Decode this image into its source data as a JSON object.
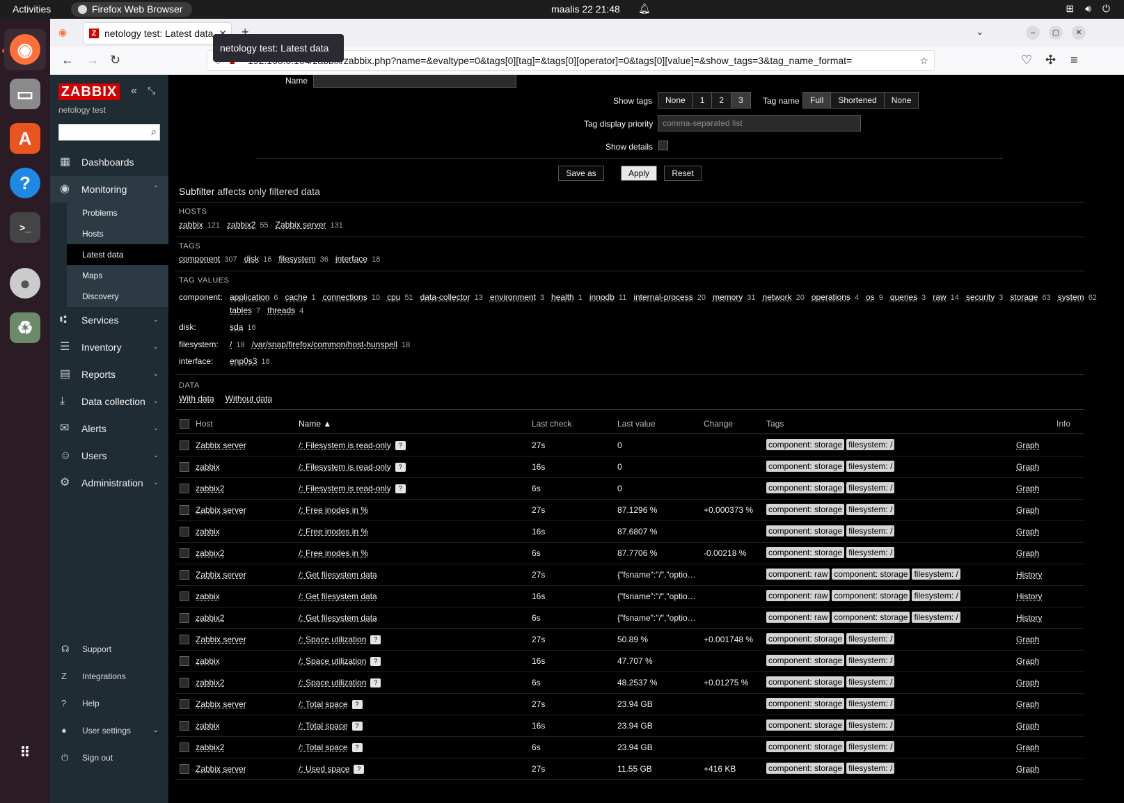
{
  "topbar": {
    "activities": "Activities",
    "app": "Firefox Web Browser",
    "clock": "maalis 22  21:48"
  },
  "browser": {
    "tab_title": "netology test: Latest data",
    "tooltip": "netology test: Latest data",
    "url": "192.168.0.104/zabbix/zabbix.php?name=&evaltype=0&tags[0][tag]=&tags[0][operator]=0&tags[0][value]=&show_tags=3&tag_name_format="
  },
  "sidebar": {
    "logo": "ZABBIX",
    "subtitle": "netology test",
    "menu": {
      "dashboards": "Dashboards",
      "monitoring": "Monitoring",
      "services": "Services",
      "inventory": "Inventory",
      "reports": "Reports",
      "data_collection": "Data collection",
      "alerts": "Alerts",
      "users": "Users",
      "administration": "Administration"
    },
    "submenu": {
      "problems": "Problems",
      "hosts": "Hosts",
      "latest": "Latest data",
      "maps": "Maps",
      "discovery": "Discovery"
    },
    "bottom": {
      "support": "Support",
      "integrations": "Integrations",
      "help": "Help",
      "user_settings": "User settings",
      "sign_out": "Sign out"
    }
  },
  "filter": {
    "name_label": "Name",
    "show_tags_label": "Show tags",
    "show_tags_options": [
      "None",
      "1",
      "2",
      "3"
    ],
    "tag_name_label": "Tag name",
    "tag_name_options": [
      "Full",
      "Shortened",
      "None"
    ],
    "tag_priority_label": "Tag display priority",
    "tag_priority_placeholder": "comma-separated list",
    "show_details_label": "Show details",
    "save_as": "Save as",
    "apply": "Apply",
    "reset": "Reset"
  },
  "subfilter": {
    "title": "Subfilter",
    "note": "affects only filtered data",
    "hosts_h": "HOSTS",
    "hosts": [
      {
        "n": "zabbix",
        "c": "121"
      },
      {
        "n": "zabbix2",
        "c": "55"
      },
      {
        "n": "Zabbix server",
        "c": "131"
      }
    ],
    "tags_h": "TAGS",
    "tags": [
      {
        "n": "component",
        "c": "307"
      },
      {
        "n": "disk",
        "c": "16"
      },
      {
        "n": "filesystem",
        "c": "36"
      },
      {
        "n": "interface",
        "c": "18"
      }
    ],
    "tag_values_h": "TAG VALUES",
    "component_label": "component:",
    "component_values_1": [
      {
        "n": "application",
        "c": "6"
      },
      {
        "n": "cache",
        "c": "1"
      },
      {
        "n": "connections",
        "c": "10"
      },
      {
        "n": "cpu",
        "c": "51"
      },
      {
        "n": "data-collector",
        "c": "13"
      },
      {
        "n": "environment",
        "c": "3"
      },
      {
        "n": "health",
        "c": "1"
      },
      {
        "n": "innodb",
        "c": "11"
      },
      {
        "n": "internal-process",
        "c": "20"
      },
      {
        "n": "memory",
        "c": "31"
      },
      {
        "n": "network",
        "c": "20"
      },
      {
        "n": "operations",
        "c": "4"
      },
      {
        "n": "os",
        "c": "9"
      },
      {
        "n": "queries",
        "c": "3"
      },
      {
        "n": "raw",
        "c": "14"
      },
      {
        "n": "security",
        "c": "3"
      },
      {
        "n": "storage",
        "c": "63"
      },
      {
        "n": "system",
        "c": "62"
      }
    ],
    "component_values_2": [
      {
        "n": "tables",
        "c": "7"
      },
      {
        "n": "threads",
        "c": "4"
      }
    ],
    "disk_label": "disk:",
    "disk_values": [
      {
        "n": "sda",
        "c": "16"
      }
    ],
    "filesystem_label": "filesystem:",
    "filesystem_values": [
      {
        "n": "/",
        "c": "18"
      },
      {
        "n": "/var/snap/firefox/common/host-hunspell",
        "c": "18"
      }
    ],
    "interface_label": "interface:",
    "interface_values": [
      {
        "n": "enp0s3",
        "c": "18"
      }
    ],
    "data_h": "DATA",
    "data_values": [
      {
        "n": "With data",
        "c": ""
      },
      {
        "n": "Without data",
        "c": ""
      }
    ]
  },
  "table": {
    "headers": {
      "host": "Host",
      "name": "Name ▲",
      "last_check": "Last check",
      "last_value": "Last value",
      "change": "Change",
      "tags": "Tags",
      "info": "Info"
    },
    "rows": [
      {
        "host": "Zabbix server",
        "name": "/: Filesystem is read-only",
        "hint": true,
        "check": "27s",
        "value": "0",
        "change": "",
        "tags": [
          "component: storage",
          "filesystem: /"
        ],
        "link": "Graph"
      },
      {
        "host": "zabbix",
        "name": "/: Filesystem is read-only",
        "hint": true,
        "check": "16s",
        "value": "0",
        "change": "",
        "tags": [
          "component: storage",
          "filesystem: /"
        ],
        "link": "Graph"
      },
      {
        "host": "zabbix2",
        "name": "/: Filesystem is read-only",
        "hint": true,
        "check": "6s",
        "value": "0",
        "change": "",
        "tags": [
          "component: storage",
          "filesystem: /"
        ],
        "link": "Graph"
      },
      {
        "host": "Zabbix server",
        "name": "/: Free inodes in %",
        "hint": false,
        "check": "27s",
        "value": "87.1296 %",
        "change": "+0.000373 %",
        "tags": [
          "component: storage",
          "filesystem: /"
        ],
        "link": "Graph"
      },
      {
        "host": "zabbix",
        "name": "/: Free inodes in %",
        "hint": false,
        "check": "16s",
        "value": "87.6807 %",
        "change": "",
        "tags": [
          "component: storage",
          "filesystem: /"
        ],
        "link": "Graph"
      },
      {
        "host": "zabbix2",
        "name": "/: Free inodes in %",
        "hint": false,
        "check": "6s",
        "value": "87.7706 %",
        "change": "-0.00218 %",
        "tags": [
          "component: storage",
          "filesystem: /"
        ],
        "link": "Graph"
      },
      {
        "host": "Zabbix server",
        "name": "/: Get filesystem data",
        "hint": false,
        "check": "27s",
        "value": "{\"fsname\":\"/\",\"optio…",
        "change": "",
        "tags": [
          "component: raw",
          "component: storage",
          "filesystem: /"
        ],
        "link": "History"
      },
      {
        "host": "zabbix",
        "name": "/: Get filesystem data",
        "hint": false,
        "check": "16s",
        "value": "{\"fsname\":\"/\",\"optio…",
        "change": "",
        "tags": [
          "component: raw",
          "component: storage",
          "filesystem: /"
        ],
        "link": "History"
      },
      {
        "host": "zabbix2",
        "name": "/: Get filesystem data",
        "hint": false,
        "check": "6s",
        "value": "{\"fsname\":\"/\",\"optio…",
        "change": "",
        "tags": [
          "component: raw",
          "component: storage",
          "filesystem: /"
        ],
        "link": "History"
      },
      {
        "host": "Zabbix server",
        "name": "/: Space utilization",
        "hint": true,
        "check": "27s",
        "value": "50.89 %",
        "change": "+0.001748 %",
        "tags": [
          "component: storage",
          "filesystem: /"
        ],
        "link": "Graph"
      },
      {
        "host": "zabbix",
        "name": "/: Space utilization",
        "hint": true,
        "check": "16s",
        "value": "47.707 %",
        "change": "",
        "tags": [
          "component: storage",
          "filesystem: /"
        ],
        "link": "Graph"
      },
      {
        "host": "zabbix2",
        "name": "/: Space utilization",
        "hint": true,
        "check": "6s",
        "value": "48.2537 %",
        "change": "+0.01275 %",
        "tags": [
          "component: storage",
          "filesystem: /"
        ],
        "link": "Graph"
      },
      {
        "host": "Zabbix server",
        "name": "/: Total space",
        "hint": true,
        "check": "27s",
        "value": "23.94 GB",
        "change": "",
        "tags": [
          "component: storage",
          "filesystem: /"
        ],
        "link": "Graph"
      },
      {
        "host": "zabbix",
        "name": "/: Total space",
        "hint": true,
        "check": "16s",
        "value": "23.94 GB",
        "change": "",
        "tags": [
          "component: storage",
          "filesystem: /"
        ],
        "link": "Graph"
      },
      {
        "host": "zabbix2",
        "name": "/: Total space",
        "hint": true,
        "check": "6s",
        "value": "23.94 GB",
        "change": "",
        "tags": [
          "component: storage",
          "filesystem: /"
        ],
        "link": "Graph"
      },
      {
        "host": "Zabbix server",
        "name": "/: Used space",
        "hint": true,
        "check": "27s",
        "value": "11.55 GB",
        "change": "+416 KB",
        "tags": [
          "component: storage",
          "filesystem: /"
        ],
        "link": "Graph"
      }
    ]
  }
}
